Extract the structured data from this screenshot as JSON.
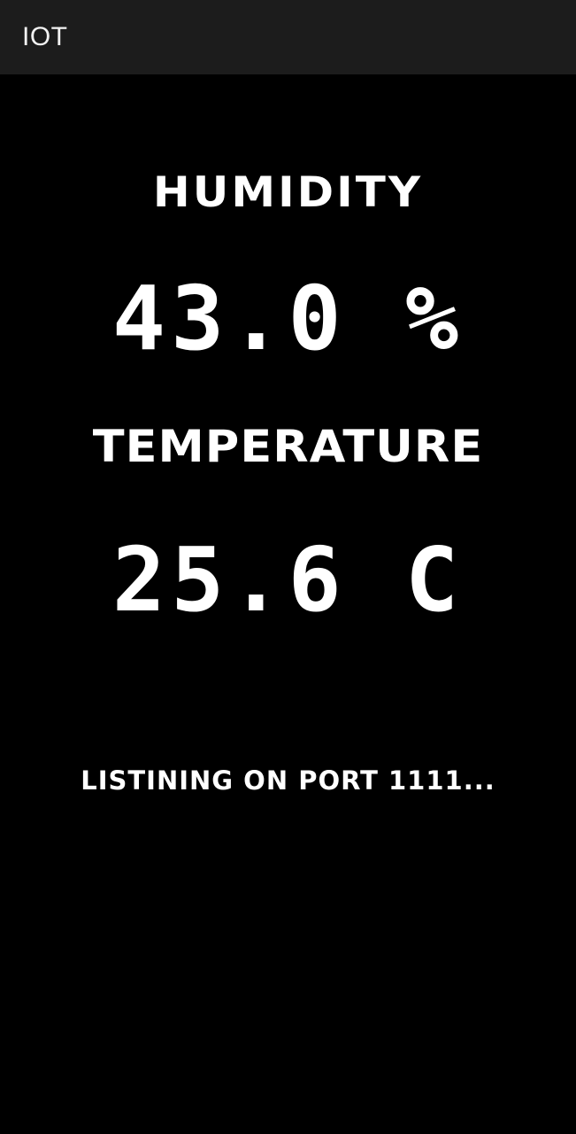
{
  "app_bar": {
    "title": "IOT"
  },
  "readings": {
    "humidity": {
      "label": "HUMIDITY",
      "value": "43.0 %"
    },
    "temperature": {
      "label": "TEMPERATURE",
      "value": "25.6 C"
    }
  },
  "status": {
    "message": "LISTINING ON PORT 1111..."
  },
  "colors": {
    "app_bar_background": "#1c1c1c",
    "background": "#000000",
    "text": "#ffffff"
  }
}
